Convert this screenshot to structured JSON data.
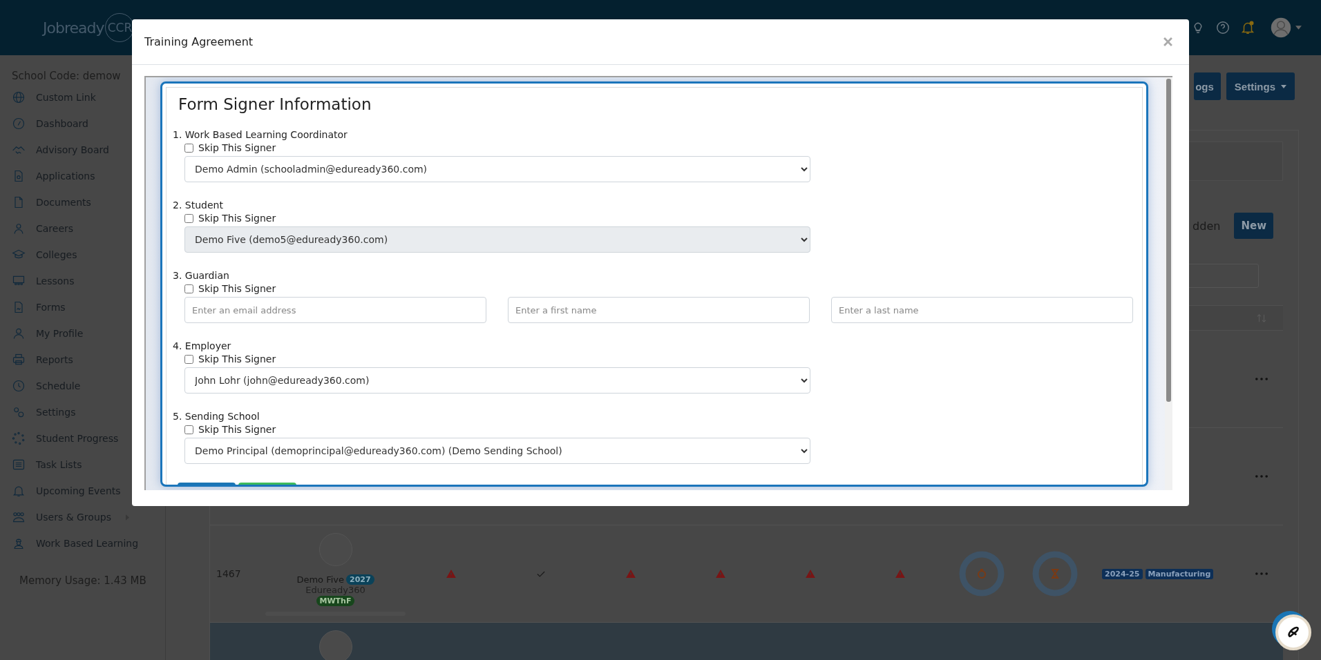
{
  "header": {
    "logo_word": "Jobready",
    "logo_mark": "CCR"
  },
  "sidebar": {
    "school_code": "School Code: demow",
    "items": [
      {
        "label": "Custom Link",
        "has_submenu": false
      },
      {
        "label": "Dashboard",
        "has_submenu": false
      },
      {
        "label": "Advisory Board",
        "has_submenu": false
      },
      {
        "label": "Applications",
        "has_submenu": false
      },
      {
        "label": "Documents",
        "has_submenu": false
      },
      {
        "label": "Careers",
        "has_submenu": false
      },
      {
        "label": "Colleges",
        "has_submenu": false
      },
      {
        "label": "Lessons",
        "has_submenu": false
      },
      {
        "label": "Forms",
        "has_submenu": false
      },
      {
        "label": "My Profile",
        "has_submenu": false
      },
      {
        "label": "Reports",
        "has_submenu": false
      },
      {
        "label": "Schedule",
        "has_submenu": false
      },
      {
        "label": "Settings",
        "has_submenu": false
      },
      {
        "label": "Student Progress",
        "has_submenu": false
      },
      {
        "label": "Task Lists",
        "has_submenu": false
      },
      {
        "label": "Upcoming Events",
        "has_submenu": false
      },
      {
        "label": "Users & Groups",
        "has_submenu": true
      },
      {
        "label": "Work Based Learning",
        "has_submenu": false
      }
    ],
    "memory": "Memory Usage: 1.43 MB"
  },
  "actions": [
    {
      "label": "ogs",
      "dropdown": false
    },
    {
      "label": "Settings",
      "dropdown": true
    }
  ],
  "list_toolbar": {
    "filter_label": "dden",
    "new_button": "New"
  },
  "table": {
    "rows": [
      {
        "kind": "covered",
        "selected": false
      },
      {
        "kind": "covered",
        "selected": false
      },
      {
        "kind": "full",
        "selected": false,
        "id": "1467",
        "name": "Demo Five",
        "year": "2027",
        "school": "Eduready360",
        "schedule": "MWThF",
        "checks": [
          {
            "kind": "warning"
          },
          {
            "kind": "check"
          },
          {
            "kind": "warning"
          },
          {
            "kind": "warning"
          },
          {
            "kind": "warning"
          },
          {
            "kind": "warning"
          }
        ],
        "tags": [
          "2024-25",
          "Manufacturing"
        ]
      },
      {
        "kind": "cut",
        "selected": true
      }
    ]
  },
  "modal": {
    "title": "Training Agreement",
    "heading": "Form Signer Information",
    "signers": [
      {
        "label": "1. Work Based Learning Coordinator",
        "skip_label": "Skip This Signer",
        "skip": false,
        "kind": "select",
        "value": "Demo Admin (schooladmin@eduready360.com)",
        "disabled": false
      },
      {
        "label": "2. Student",
        "skip_label": "Skip This Signer",
        "skip": false,
        "kind": "select",
        "value": "Demo Five (demo5@eduready360.com)",
        "disabled": true
      },
      {
        "label": "3. Guardian",
        "skip_label": "Skip This Signer",
        "skip": false,
        "kind": "fields",
        "fields": [
          {
            "placeholder": "Enter an email address"
          },
          {
            "placeholder": "Enter a first name"
          },
          {
            "placeholder": "Enter a last name"
          }
        ]
      },
      {
        "label": "4. Employer",
        "skip_label": "Skip This Signer",
        "skip": false,
        "kind": "select",
        "value": "John Lohr (john@eduready360.com)",
        "disabled": false
      },
      {
        "label": "5. Sending School",
        "skip_label": "Skip This Signer",
        "skip": false,
        "kind": "select",
        "value": "Demo Principal (demoprincipal@eduready360.com) (Demo Sending School)",
        "disabled": false
      }
    ],
    "buttons": [
      {
        "kind": "primary"
      },
      {
        "kind": "success"
      }
    ]
  }
}
